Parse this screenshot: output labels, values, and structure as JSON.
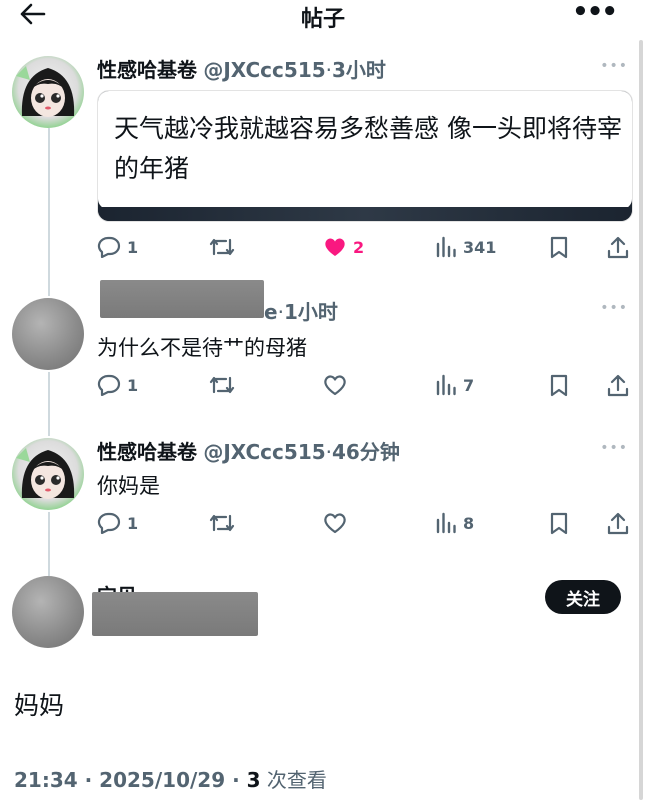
{
  "header": {
    "title": "帖子",
    "back_icon": "arrow-left-icon",
    "more_icon": "more-horizontal-icon"
  },
  "posts": [
    {
      "name": "性感哈基卷",
      "handle": "@JXCcc515",
      "sep": "·",
      "time": "3小时",
      "media_text": "天气越冷我就越容易多愁善感 像一头即将待宰的年猪",
      "stats": {
        "replies": "1",
        "reposts": "",
        "likes": "2",
        "views": "341"
      },
      "liked": true
    },
    {
      "name_suffix": "e",
      "sep": "·",
      "time": "1小时",
      "text": "为什么不是待艹的母猪",
      "stats": {
        "replies": "1",
        "reposts": "",
        "likes": "",
        "views": "7"
      },
      "liked": false
    },
    {
      "name": "性感哈基卷",
      "handle": "@JXCcc515",
      "sep": "·",
      "time": "46分钟",
      "text": "你妈是",
      "stats": {
        "replies": "1",
        "reposts": "",
        "likes": "",
        "views": "8"
      },
      "liked": false
    }
  ],
  "main_post": {
    "name_partial": "宝贝",
    "follow_label": "关注",
    "text": "妈妈",
    "timestamp": "21:34 · 2025/10/29 · ",
    "views": "3",
    "views_label": " 次查看"
  },
  "colors": {
    "text": "#0f1419",
    "secondary": "#536471",
    "like": "#f91880",
    "thread_line": "#cfd9de"
  }
}
